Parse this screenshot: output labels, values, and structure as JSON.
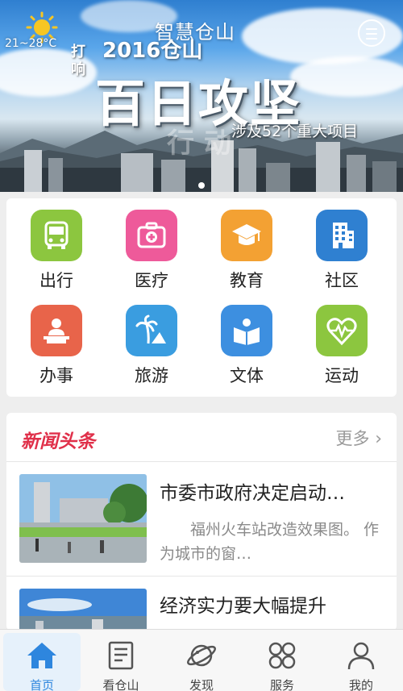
{
  "status": {
    "weather_icon": "sun-icon",
    "temperature": "21~28°C"
  },
  "header": {
    "app_title": "智慧仓山",
    "menu_icon": "menu-icon"
  },
  "banner": {
    "tag": "打响",
    "year_line": "2016仓山",
    "headline": "百日攻坚",
    "subline": "涉及52个重大项目",
    "ghost_text": "行 动"
  },
  "services": [
    {
      "label": "出行",
      "icon": "bus-icon",
      "color": "#8cc63f"
    },
    {
      "label": "医疗",
      "icon": "medical-kit-icon",
      "color": "#ee5a9a"
    },
    {
      "label": "教育",
      "icon": "graduation-cap-icon",
      "color": "#f3a133"
    },
    {
      "label": "社区",
      "icon": "building-icon",
      "color": "#2f80d1"
    },
    {
      "label": "办事",
      "icon": "clerk-icon",
      "color": "#e8644a"
    },
    {
      "label": "旅游",
      "icon": "palm-tree-icon",
      "color": "#3a9de0"
    },
    {
      "label": "文体",
      "icon": "book-icon",
      "color": "#3d8fe0"
    },
    {
      "label": "运动",
      "icon": "heartbeat-icon",
      "color": "#8cc63f"
    }
  ],
  "news": {
    "section_title": "新闻头条",
    "more_label": "更多",
    "items": [
      {
        "title": "市委市政府决定启动…",
        "summary": "福州火车站改造效果图。  作为城市的窗…"
      },
      {
        "title": "经济实力要大幅提升",
        "summary": ""
      }
    ]
  },
  "tabs": [
    {
      "label": "首页",
      "icon": "home-icon",
      "active": true
    },
    {
      "label": "看仓山",
      "icon": "newspaper-icon",
      "active": false
    },
    {
      "label": "发现",
      "icon": "planet-icon",
      "active": false
    },
    {
      "label": "服务",
      "icon": "grid-icon",
      "active": false
    },
    {
      "label": "我的",
      "icon": "user-icon",
      "active": false
    }
  ],
  "colors": {
    "accent": "#2e86de",
    "news_red": "#e0304a"
  }
}
